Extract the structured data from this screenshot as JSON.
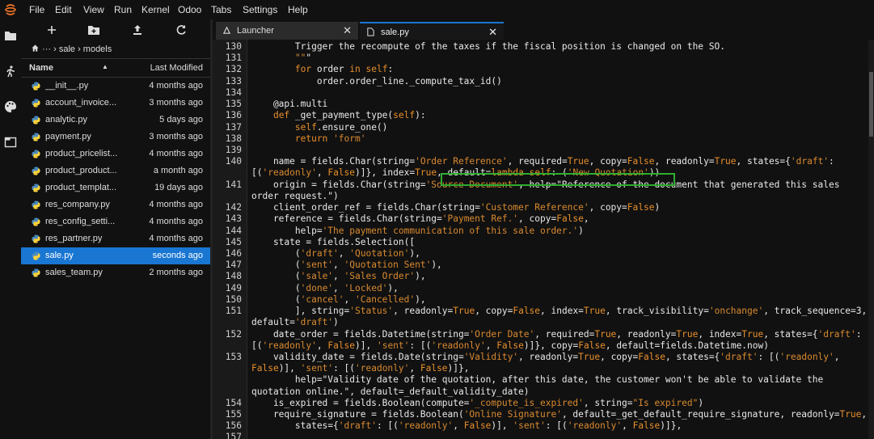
{
  "menubar": {
    "items": [
      "File",
      "Edit",
      "View",
      "Run",
      "Kernel",
      "Odoo",
      "Tabs",
      "Settings",
      "Help"
    ]
  },
  "left_strip_icons": [
    "folder-icon",
    "running-icon",
    "palette-icon",
    "tab-icon"
  ],
  "filebrowser": {
    "toolbar_icons": [
      "new-launcher-icon",
      "new-folder-icon",
      "upload-icon",
      "refresh-icon"
    ],
    "breadcrumb": {
      "home": "home-icon",
      "text": "··· › sale › models"
    },
    "header": {
      "name": "Name",
      "modified": "Last Modified"
    },
    "files": [
      {
        "name": "__init__.py",
        "modified": "4 months ago"
      },
      {
        "name": "account_invoice...",
        "modified": "3 months ago"
      },
      {
        "name": "analytic.py",
        "modified": "5 days ago"
      },
      {
        "name": "payment.py",
        "modified": "3 months ago"
      },
      {
        "name": "product_pricelist...",
        "modified": "4 months ago"
      },
      {
        "name": "product_product...",
        "modified": "a month ago"
      },
      {
        "name": "product_templat...",
        "modified": "19 days ago"
      },
      {
        "name": "res_company.py",
        "modified": "4 months ago"
      },
      {
        "name": "res_config_setti...",
        "modified": "4 months ago"
      },
      {
        "name": "res_partner.py",
        "modified": "4 months ago"
      },
      {
        "name": "sale.py",
        "modified": "seconds ago",
        "selected": true
      },
      {
        "name": "sales_team.py",
        "modified": "2 months ago"
      }
    ]
  },
  "tabs": [
    {
      "label": "Launcher",
      "active": false
    },
    {
      "label": "sale.py",
      "active": true
    }
  ],
  "editor": {
    "lines": [
      {
        "n": "130",
        "t": "        Trigger the recompute of the taxes if the fiscal position is changed on the SO."
      },
      {
        "n": "131",
        "t": "        \"\"\""
      },
      {
        "n": "132",
        "t": "        for order in self:"
      },
      {
        "n": "133",
        "t": "            order.order_line._compute_tax_id()"
      },
      {
        "n": "134",
        "t": ""
      },
      {
        "n": "135",
        "t": "    @api.multi"
      },
      {
        "n": "136",
        "t": "    def _get_payment_type(self):"
      },
      {
        "n": "137",
        "t": "        self.ensure_one()"
      },
      {
        "n": "138",
        "t": "        return 'form'"
      },
      {
        "n": "139",
        "t": ""
      },
      {
        "n": "140",
        "t": "    name = fields.Char(string='Order Reference', required=True, copy=False, readonly=True, states={'draft':"
      },
      {
        "n": "",
        "t": "[('readonly', False)]}, index=True, default=lambda self: ('New Quotation'))"
      },
      {
        "n": "141",
        "t": "    origin = fields.Char(string='Source Document', help=\"Reference of the document that generated this sales"
      },
      {
        "n": "",
        "t": "order request.\")"
      },
      {
        "n": "142",
        "t": "    client_order_ref = fields.Char(string='Customer Reference', copy=False)"
      },
      {
        "n": "143",
        "t": "    reference = fields.Char(string='Payment Ref.', copy=False,"
      },
      {
        "n": "144",
        "t": "        help='The payment communication of this sale order.')"
      },
      {
        "n": "145",
        "t": "    state = fields.Selection(["
      },
      {
        "n": "146",
        "t": "        ('draft', 'Quotation'),"
      },
      {
        "n": "147",
        "t": "        ('sent', 'Quotation Sent'),"
      },
      {
        "n": "148",
        "t": "        ('sale', 'Sales Order'),"
      },
      {
        "n": "149",
        "t": "        ('done', 'Locked'),"
      },
      {
        "n": "150",
        "t": "        ('cancel', 'Cancelled'),"
      },
      {
        "n": "151",
        "t": "        ], string='Status', readonly=True, copy=False, index=True, track_visibility='onchange', track_sequence=3,"
      },
      {
        "n": "",
        "t": "default='draft')"
      },
      {
        "n": "152",
        "t": "    date_order = fields.Datetime(string='Order Date', required=True, readonly=True, index=True, states={'draft':"
      },
      {
        "n": "",
        "t": "[('readonly', False)], 'sent': [('readonly', False)]}, copy=False, default=fields.Datetime.now)"
      },
      {
        "n": "153",
        "t": "    validity_date = fields.Date(string='Validity', readonly=True, copy=False, states={'draft': [('readonly',"
      },
      {
        "n": "",
        "t": "False)], 'sent': [('readonly', False)]},"
      },
      {
        "n": "",
        "t": "        help=\"Validity date of the quotation, after this date, the customer won't be able to validate the"
      },
      {
        "n": "",
        "t": "quotation online.\", default=_default_validity_date)"
      },
      {
        "n": "154",
        "t": "    is_expired = fields.Boolean(compute='_compute_is_expired', string=\"Is expired\")"
      },
      {
        "n": "155",
        "t": "    require_signature = fields.Boolean('Online Signature', default=_get_default_require_signature, readonly=True,"
      },
      {
        "n": "156",
        "t": "        states={'draft': [('readonly', False)], 'sent': [('readonly', False)]},"
      },
      {
        "n": "157",
        "t": ""
      }
    ]
  }
}
